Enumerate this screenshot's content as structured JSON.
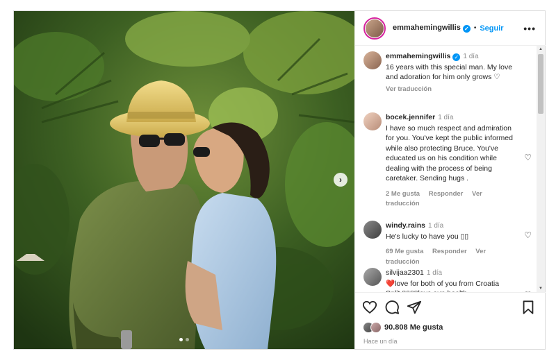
{
  "post": {
    "author": "emmahemingwillis",
    "follow_label": "Seguir",
    "more_label": "•••",
    "dot": "•"
  },
  "caption": {
    "user": "emmahemingwillis",
    "time": "1 día",
    "text": "16 years with this special man. My love and adoration for him only grows ♡",
    "translate": "Ver traducción"
  },
  "comments": [
    {
      "user": "bocek.jennifer",
      "time": "1 día",
      "text": "I have so much respect and admiration for you. You've kept the public informed while also protecting Bruce. You've educated us on his condition while dealing with the process of being caretaker. Sending hugs .",
      "likes": "2 Me gusta",
      "reply": "Responder",
      "translate": "Ver traducción"
    },
    {
      "user": "windy.rains",
      "time": "1 día",
      "text": "He's lucky to have you ▯▯",
      "likes": "69 Me gusta",
      "reply": "Responder",
      "translate": "Ver traducción"
    },
    {
      "user": "silvijaa2301",
      "time": "1 día",
      "text": "❤️love for both of you from Croatia Split ▯▯▯▯love sun health"
    }
  ],
  "footer": {
    "likes": "90.808 Me gusta",
    "time_ago": "Hace un día"
  },
  "colors": {
    "accent": "#0095f6",
    "muted": "#8e8e8e",
    "text": "#262626"
  },
  "icons": {
    "verified": "verified-badge-icon",
    "next": "chevron-right-icon",
    "like": "heart-icon",
    "comment": "comment-icon",
    "share": "paper-plane-icon",
    "save": "bookmark-icon"
  }
}
